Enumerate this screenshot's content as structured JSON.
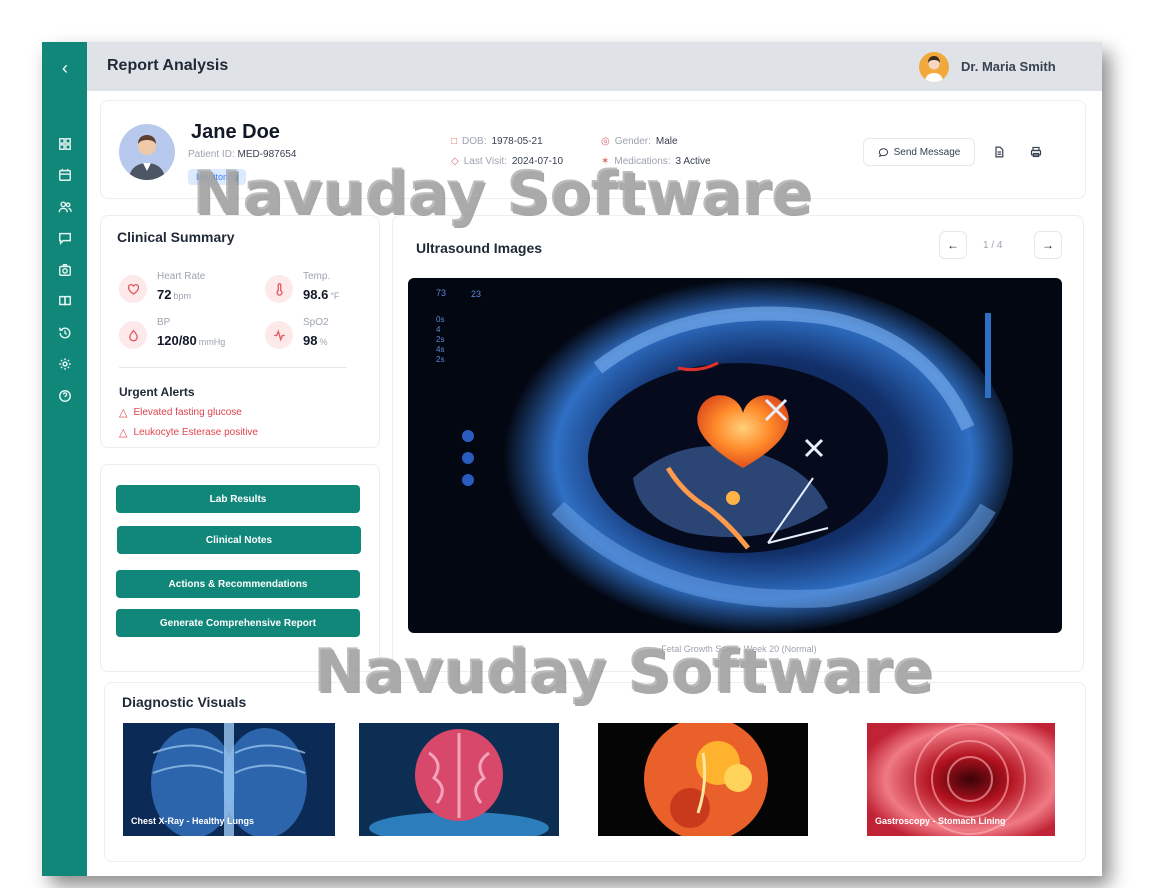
{
  "header": {
    "title": "Report Analysis",
    "user_name": "Dr. Maria Smith"
  },
  "sidebar": {
    "back_icon": "chevron-left-icon",
    "items": [
      "dashboard-icon",
      "calendar-icon",
      "users-icon",
      "message-icon",
      "camera-icon",
      "book-icon",
      "history-icon",
      "settings-icon",
      "help-icon"
    ]
  },
  "patient": {
    "name": "Jane Doe",
    "id_label": "Patient ID:",
    "id_value": "MED-987654",
    "status": "Monitoring",
    "dob_label": "DOB:",
    "dob_value": "1978-05-21",
    "gender_label": "Gender:",
    "gender_value": "Male",
    "last_visit_label": "Last Visit:",
    "last_visit_value": "2024-07-10",
    "medications_label": "Medications:",
    "medications_value": "3 Active",
    "send_message": "Send Message"
  },
  "summary": {
    "title": "Clinical Summary",
    "vitals": [
      {
        "label": "Heart Rate",
        "value": "72",
        "unit": "bpm",
        "icon": "heart-icon"
      },
      {
        "label": "Temp.",
        "value": "98.6",
        "unit": "°F",
        "icon": "thermometer-icon"
      },
      {
        "label": "BP",
        "value": "120/80",
        "unit": "mmHg",
        "icon": "droplet-icon"
      },
      {
        "label": "SpO2",
        "value": "98",
        "unit": "%",
        "icon": "activity-icon"
      }
    ],
    "alerts_title": "Urgent Alerts",
    "alerts": [
      "Elevated fasting glucose",
      "Leukocyte Esterase positive"
    ]
  },
  "actions": {
    "lab_results": "Lab Results",
    "clinical_notes": "Clinical Notes",
    "recommendations": "Actions & Recommendations",
    "report": "Generate Comprehensive Report"
  },
  "ultrasound": {
    "title": "Ultrasound Images",
    "counter": "1 / 4",
    "caption": "Fetal Growth Scan - Week 20 (Normal)",
    "overlay_top": [
      "73",
      "23"
    ],
    "overlay_side": [
      "0s",
      "4",
      "2s",
      "4s",
      "2s"
    ]
  },
  "diagnostics": {
    "title": "Diagnostic Visuals",
    "items": [
      {
        "label": "Chest X-Ray - Healthy Lungs"
      },
      {
        "label": ""
      },
      {
        "label": ""
      },
      {
        "label": "Gastroscopy - Stomach Lining"
      }
    ]
  },
  "watermark": "Navuday Software"
}
